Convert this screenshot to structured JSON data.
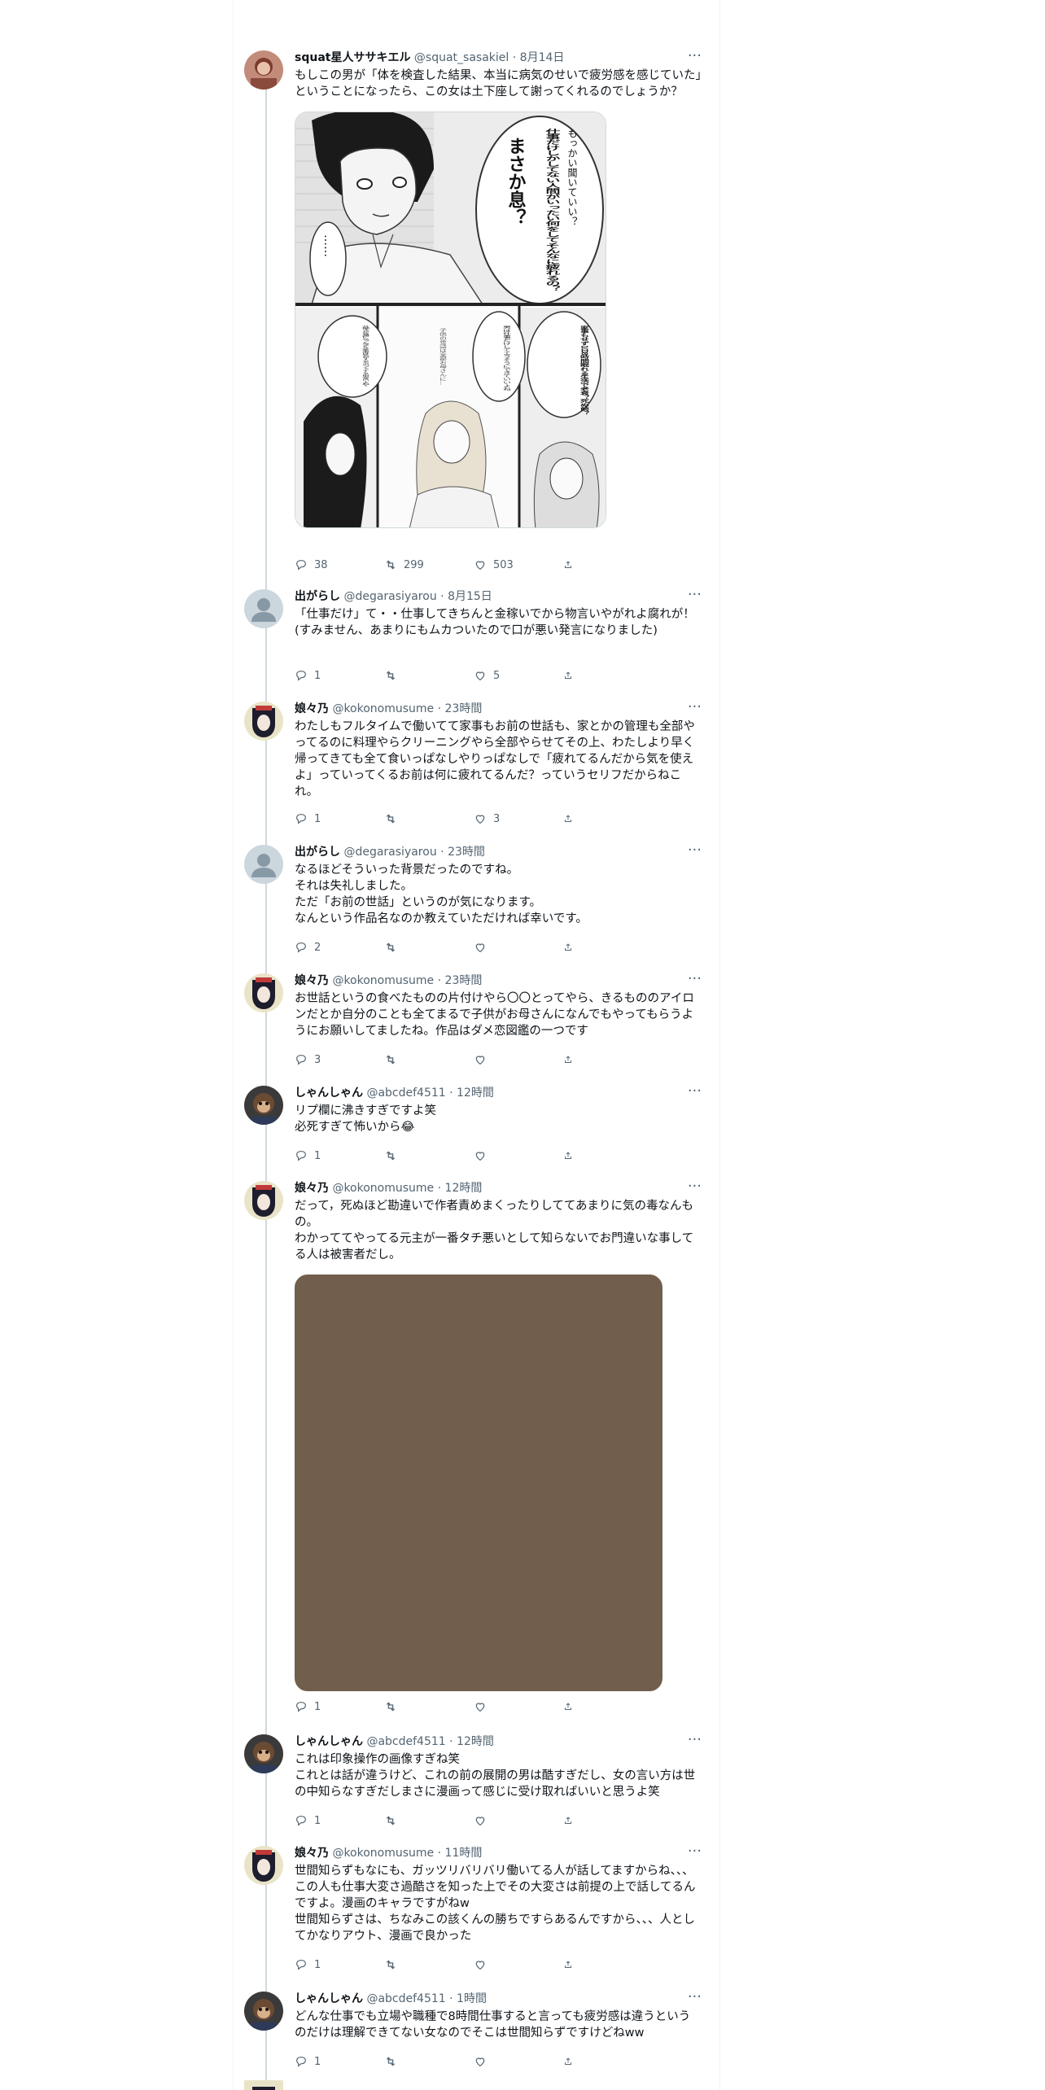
{
  "tweets": [
    {
      "name": "squat星人ササキエル",
      "handle": "@squat_sasakiel",
      "dot": "·",
      "time": "8月14日",
      "text": "もしこの男が「体を検査した結果、本当に病気のせいで疲労感を感じていた」ということになったら、この女は土下座して謝ってくれるのでしょうか？",
      "media": "manga",
      "replies": "38",
      "retweets": "299",
      "likes": "503"
    },
    {
      "name": "出がらし",
      "handle": "@degarasiyarou",
      "dot": "·",
      "time": "8月15日",
      "text": "「仕事だけ」て・・仕事してきちんと金稼いでから物言いやがれよ腐れが！\n(すみません、あまりにもムカついたので口が悪い発言になりました)",
      "replies": "1",
      "retweets": "",
      "likes": "5"
    },
    {
      "name": "娘々乃",
      "handle": "@kokonomusume",
      "dot": "·",
      "time": "23時間",
      "text": "わたしもフルタイムで働いてて家事もお前の世話も、家とかの管理も全部やってるのに料理やらクリーニングやら全部やらせてその上、わたしより早く帰ってきても全て食いっぱなしやりっぱなしで「疲れてるんだから気を使えよ」っていってくるお前は何に疲れてるんだ？っていうセリフだからねこれ。",
      "replies": "1",
      "retweets": "",
      "likes": "3"
    },
    {
      "name": "出がらし",
      "handle": "@degarasiyarou",
      "dot": "·",
      "time": "23時間",
      "text": "なるほどそういった背景だったのですね。\nそれは失礼しました。\nただ「お前の世話」というのが気になります。\nなんという作品名なのか教えていただければ幸いです。",
      "replies": "2",
      "retweets": "",
      "likes": ""
    },
    {
      "name": "娘々乃",
      "handle": "@kokonomusume",
      "dot": "·",
      "time": "23時間",
      "text": "お世話というの食べたものの片付けやら〇〇とってやら、きるもののアイロンだとか自分のことも全てまるで子供がお母さんになんでもやってもらうようにお願いしてましたね。作品はダメ恋図鑑の一つです",
      "replies": "3",
      "retweets": "",
      "likes": ""
    },
    {
      "name": "しゃんしゃん",
      "handle": "@abcdef4511",
      "dot": "·",
      "time": "12時間",
      "text": "リプ欄に沸きすぎですよ笑\n必死すぎて怖いから😂",
      "replies": "1",
      "retweets": "",
      "likes": ""
    },
    {
      "name": "娘々乃",
      "handle": "@kokonomusume",
      "dot": "·",
      "time": "12時間",
      "text": "だって，死ぬほど勘違いで作者責めまくったりしててあまりに気の毒なんもの。\nわかっててやってる元主が一番タチ悪いとして知らないでお門違いな事してる人は被害者だし。",
      "media": "brown",
      "replies": "1",
      "retweets": "",
      "likes": ""
    },
    {
      "name": "しゃんしゃん",
      "handle": "@abcdef4511",
      "dot": "·",
      "time": "12時間",
      "text": "これは印象操作の画像すぎね笑\nこれとは話が違うけど、これの前の展開の男は酷すぎだし、女の言い方は世の中知らなすぎだしまさに漫画って感じに受け取ればいいと思うよ笑",
      "replies": "1",
      "retweets": "",
      "likes": ""
    },
    {
      "name": "娘々乃",
      "handle": "@kokonomusume",
      "dot": "·",
      "time": "11時間",
      "text": "世間知らずもなにも、ガッツリバリバリ働いてる人が話してますからね、、、この人も仕事大変さ過酷さを知った上でその大変さは前提の上で話してるんですよ。漫画のキャラですがねw\n世間知らずさは、ちなみこの該くんの勝ちですらあるんですから、、、人としてかなりアウト、漫画で良かった",
      "replies": "1",
      "retweets": "",
      "likes": ""
    },
    {
      "name": "しゃんしゃん",
      "handle": "@abcdef4511",
      "dot": "·",
      "time": "1時間",
      "text": "どんな仕事でも立場や職種で8時間仕事すると言っても疲労感は違うというのだけは理解できてない女なのでそこは世間知らずですけどねww",
      "replies": "1",
      "retweets": "",
      "likes": ""
    }
  ],
  "manga": {
    "bubble_top": "もっかい聞いていい？",
    "bubble_main": "仕事だけしかしてない人間がいったい何をしてそんなに疲れるの？",
    "bubble_emph": "まさか息？",
    "bubble_ellipsis": "……",
    "bubble_b1": "家事もせず1日8時間眠れる生活で老衰？死ぬ前？",
    "bubble_b2": "男は仕事だけしてエラそうにできていいよね",
    "bubble_b3": "共働きが普通になった今どき家事は女がするものってアナタの男多いよね～",
    "bubble_b4": "子供の世話は全部お母さんに…"
  },
  "colors": {
    "brown_media": "#725e4d",
    "text_secondary": "#536471",
    "thread_line": "#cfd9de"
  }
}
